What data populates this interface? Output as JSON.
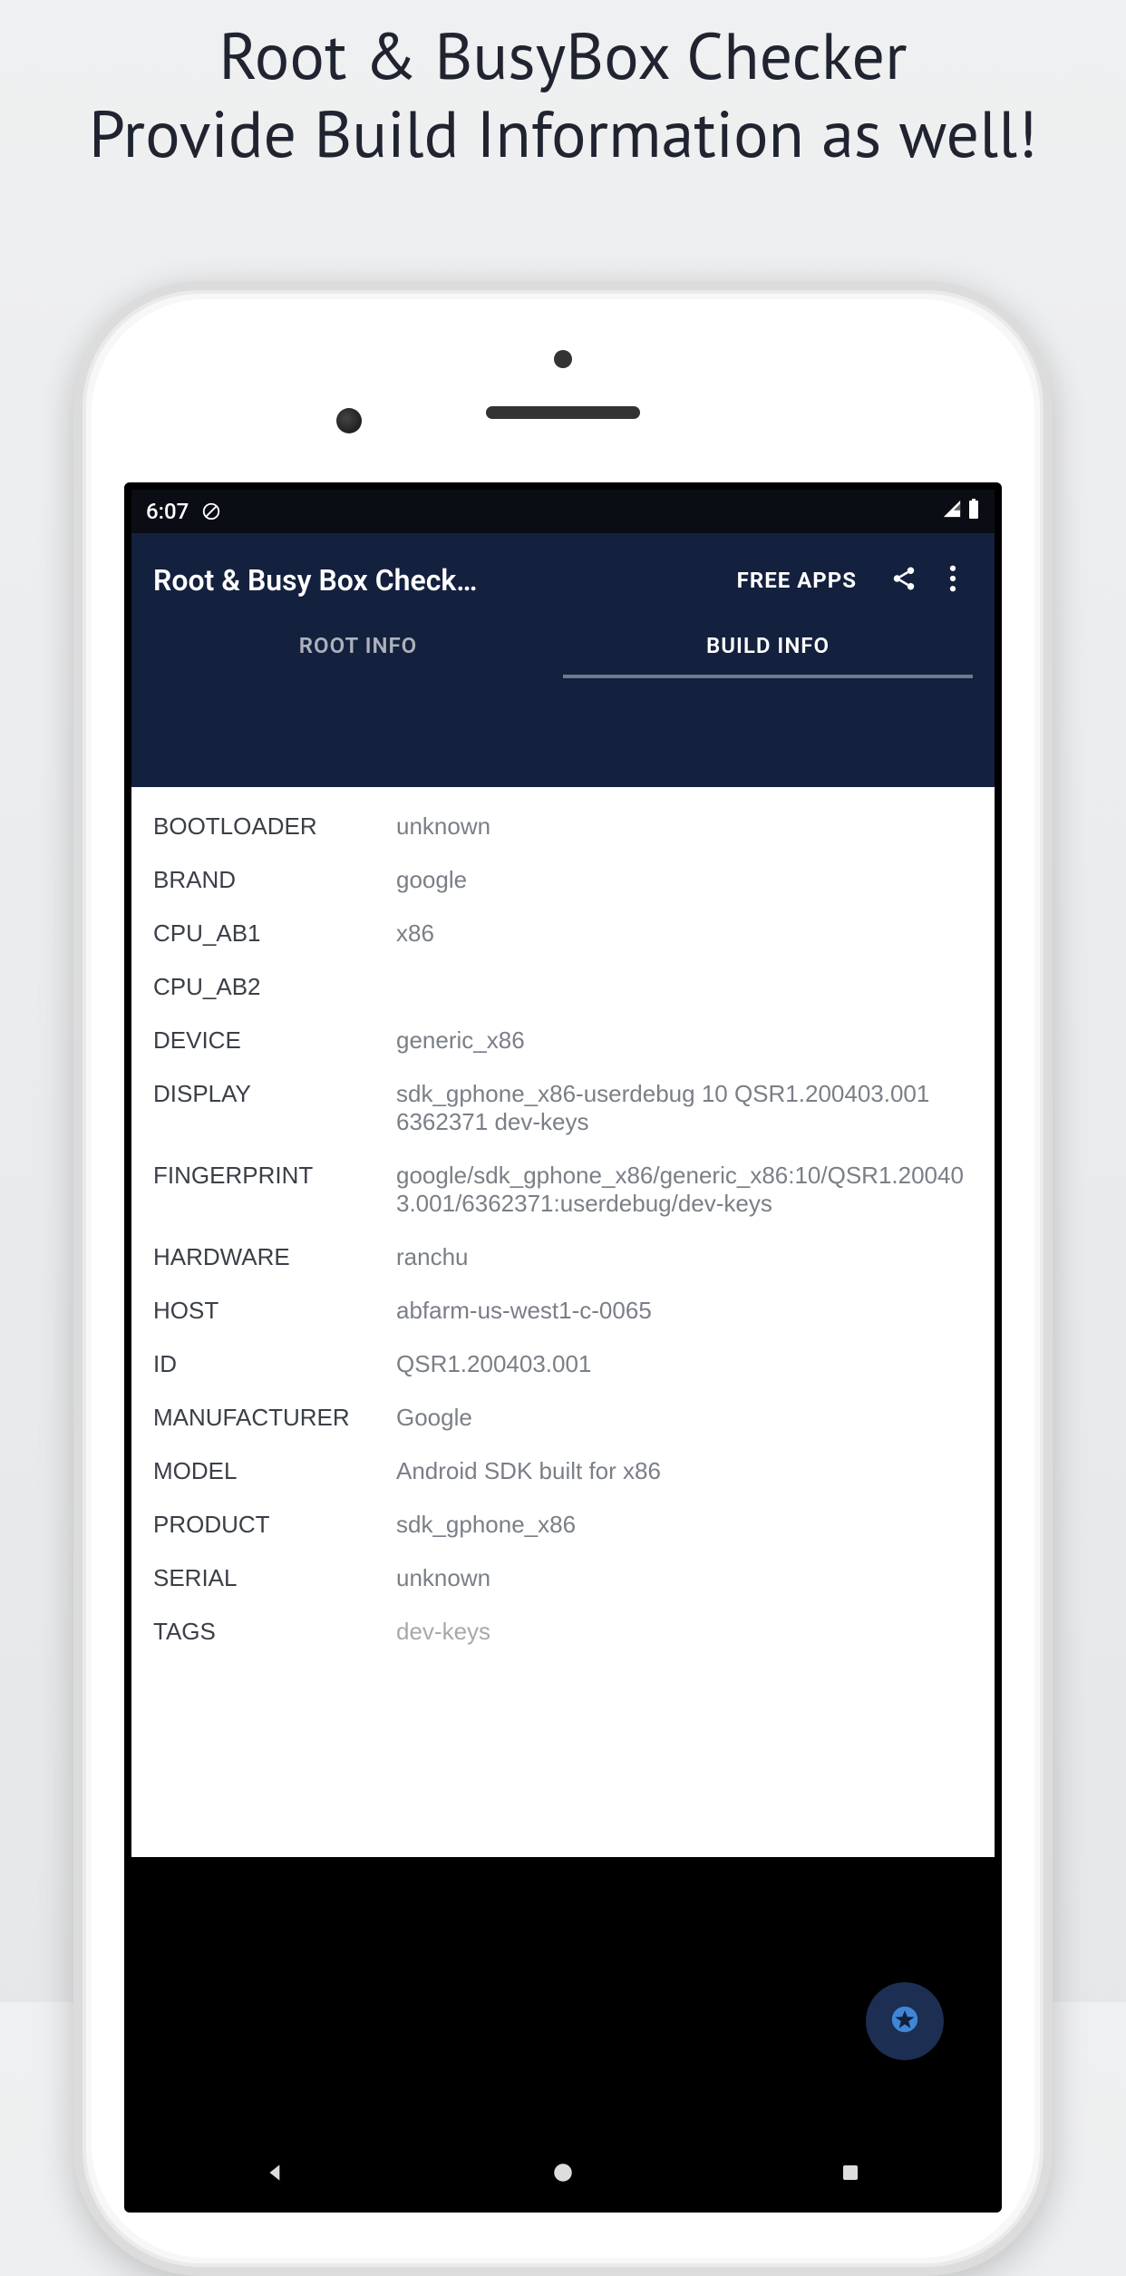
{
  "promo": {
    "line1": "Root & BusyBox Checker",
    "line2": "Provide Build Information as well!"
  },
  "statusbar": {
    "time": "6:07"
  },
  "appbar": {
    "title": "Root & Busy Box Check…",
    "free_apps": "FREE APPS"
  },
  "tabs": {
    "root_info": "ROOT INFO",
    "build_info": "BUILD INFO"
  },
  "build": {
    "bootloader_k": "BOOTLOADER",
    "bootloader_v": "unknown",
    "brand_k": "BRAND",
    "brand_v": "google",
    "cpuab1_k": "CPU_AB1",
    "cpuab1_v": "x86",
    "cpuab2_k": "CPU_AB2",
    "cpuab2_v": "",
    "device_k": "DEVICE",
    "device_v": "generic_x86",
    "display_k": "DISPLAY",
    "display_v": "sdk_gphone_x86-userdebug 10 QSR1.200403.001 6362371 dev-keys",
    "fingerprint_k": "FINGERPRINT",
    "fingerprint_v": "google/sdk_gphone_x86/generic_x86:10/QSR1.200403.001/6362371:userdebug/dev-keys",
    "hardware_k": "HARDWARE",
    "hardware_v": "ranchu",
    "host_k": "HOST",
    "host_v": "abfarm-us-west1-c-0065",
    "id_k": "ID",
    "id_v": "QSR1.200403.001",
    "manufacturer_k": "MANUFACTURER",
    "manufacturer_v": "Google",
    "model_k": "MODEL",
    "model_v": "Android SDK built for x86",
    "product_k": "PRODUCT",
    "product_v": "sdk_gphone_x86",
    "serial_k": "SERIAL",
    "serial_v": "unknown",
    "tags_k": "TAGS",
    "tags_v": "dev-keys"
  }
}
